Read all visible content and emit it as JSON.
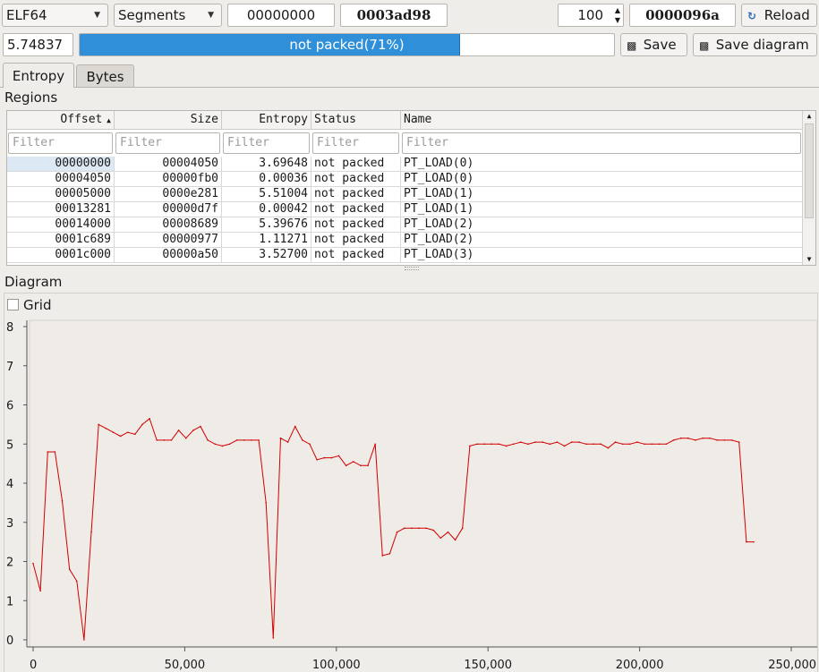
{
  "toolbar": {
    "file_type": "ELF64",
    "mode": "Segments",
    "offset": "00000000",
    "size": "0003ad98",
    "block_count": "100",
    "block_size": "0000096a",
    "reload_label": "Reload"
  },
  "status": {
    "total_entropy": "5.74837",
    "progress_text": "not packed(71%)",
    "progress_fraction": 0.71,
    "save_label": "Save",
    "save_diagram_label": "Save diagram"
  },
  "tabs": [
    "Entropy",
    "Bytes"
  ],
  "regions": {
    "title": "Regions",
    "columns": [
      "Offset",
      "Size",
      "Entropy",
      "Status",
      "Name"
    ],
    "filter_placeholder": "Filter",
    "rows": [
      [
        "00000000",
        "00004050",
        "3.69648",
        "not packed",
        "PT_LOAD(0)"
      ],
      [
        "00004050",
        "00000fb0",
        "0.00036",
        "not packed",
        "PT_LOAD(0)"
      ],
      [
        "00005000",
        "0000e281",
        "5.51004",
        "not packed",
        "PT_LOAD(1)"
      ],
      [
        "00013281",
        "00000d7f",
        "0.00042",
        "not packed",
        "PT_LOAD(1)"
      ],
      [
        "00014000",
        "00008689",
        "5.39676",
        "not packed",
        "PT_LOAD(2)"
      ],
      [
        "0001c689",
        "00000977",
        "1.11271",
        "not packed",
        "PT_LOAD(2)"
      ],
      [
        "0001c000",
        "00000a50",
        "3.52700",
        "not packed",
        "PT_LOAD(3)"
      ]
    ]
  },
  "diagram": {
    "title": "Diagram",
    "grid_label": "Grid",
    "grid_checked": false
  },
  "chart_data": {
    "type": "line",
    "color": "#d00000",
    "grid": false,
    "xlim": [
      0,
      250000
    ],
    "ylim": [
      0,
      8
    ],
    "xticks": [
      "0",
      "50,000",
      "100,000",
      "150,000",
      "200,000",
      "250,000"
    ],
    "yticks": [
      "0",
      "1",
      "2",
      "3",
      "4",
      "5",
      "6",
      "7",
      "8"
    ],
    "x": [
      0,
      2400,
      4800,
      7200,
      9600,
      12000,
      14400,
      16800,
      19200,
      21600,
      24000,
      26400,
      28800,
      31200,
      33600,
      36000,
      38400,
      40800,
      43200,
      45600,
      48000,
      50400,
      52800,
      55200,
      57600,
      60000,
      62400,
      64800,
      67200,
      69600,
      72000,
      74400,
      76800,
      79200,
      81600,
      84000,
      86400,
      88800,
      91200,
      93600,
      96000,
      98400,
      100800,
      103200,
      105600,
      108000,
      110400,
      112800,
      115200,
      117600,
      120000,
      122400,
      124800,
      127200,
      129600,
      132000,
      134400,
      136800,
      139200,
      141600,
      144000,
      146400,
      148800,
      151200,
      153600,
      156000,
      158400,
      160800,
      163200,
      165600,
      168000,
      170400,
      172800,
      175200,
      177600,
      180000,
      182400,
      184800,
      187200,
      189600,
      192000,
      194400,
      196800,
      199200,
      201600,
      204000,
      206400,
      208800,
      211200,
      213600,
      216000,
      218400,
      220800,
      223200,
      225600,
      228000,
      230400,
      232800,
      235200,
      237600
    ],
    "y": [
      1.95,
      1.25,
      4.8,
      4.8,
      3.55,
      1.8,
      1.5,
      0.0,
      2.75,
      5.5,
      5.4,
      5.3,
      5.2,
      5.3,
      5.25,
      5.5,
      5.65,
      5.1,
      5.1,
      5.1,
      5.35,
      5.15,
      5.35,
      5.45,
      5.1,
      5.0,
      4.95,
      5.0,
      5.1,
      5.1,
      5.1,
      5.1,
      3.5,
      0.05,
      5.15,
      5.05,
      5.45,
      5.1,
      5.0,
      4.6,
      4.65,
      4.65,
      4.7,
      4.45,
      4.55,
      4.45,
      4.45,
      5.0,
      2.15,
      2.2,
      2.75,
      2.85,
      2.85,
      2.85,
      2.85,
      2.8,
      2.6,
      2.75,
      2.55,
      2.85,
      4.95,
      5.0,
      5.0,
      5.0,
      5.0,
      4.95,
      5.0,
      5.05,
      5.0,
      5.05,
      5.05,
      5.0,
      5.05,
      4.95,
      5.05,
      5.05,
      5.0,
      5.0,
      5.0,
      4.9,
      5.05,
      5.0,
      5.0,
      5.05,
      5.0,
      5.0,
      5.0,
      5.0,
      5.1,
      5.15,
      5.15,
      5.1,
      5.15,
      5.15,
      5.1,
      5.1,
      5.1,
      5.05,
      2.5,
      2.5
    ]
  }
}
